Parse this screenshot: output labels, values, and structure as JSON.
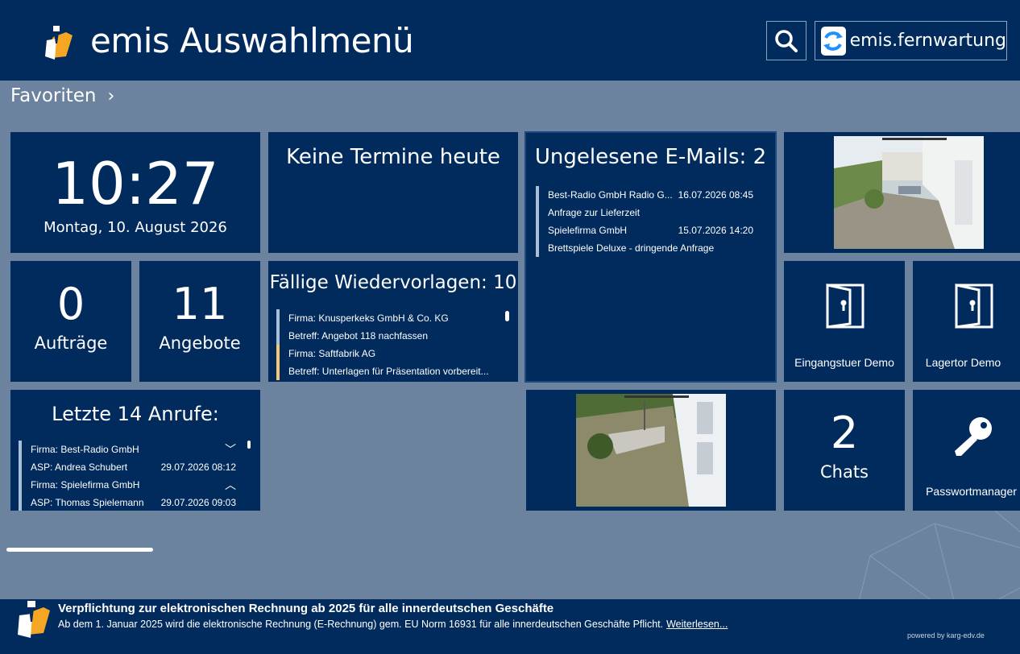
{
  "header": {
    "title": "emis Auswahlmenü",
    "fernwartung_label": "emis.fernwartung"
  },
  "favorites": {
    "label": "Favoriten"
  },
  "clock": {
    "time": "10:27",
    "date": "Montag, 10. August 2026"
  },
  "appointments": {
    "title": "Keine Termine heute"
  },
  "emails": {
    "title": "Ungelesene E-Mails: 2",
    "items": [
      {
        "from": "Best-Radio GmbH Radio G...",
        "date": "16.07.2026 08:45",
        "subject": "Anfrage zur Lieferzeit"
      },
      {
        "from": "Spielefirma GmbH",
        "date": "15.07.2026 14:20",
        "subject": "Brettspiele Deluxe - dringende Anfrage"
      }
    ]
  },
  "orders": {
    "count": "0",
    "label": "Aufträge"
  },
  "offers": {
    "count": "11",
    "label": "Angebote"
  },
  "followups": {
    "title": "Fällige Wiedervorlagen: 10",
    "items": [
      {
        "company": "Firma: Knusperkeks GmbH & Co. KG",
        "subject": "Betreff: Angebot 118 nachfassen",
        "color": "#a9bfd6"
      },
      {
        "company": "Firma: Saftfabrik AG",
        "subject": "Betreff: Unterlagen für Präsentation vorbereit...",
        "color": "#f2c77a"
      }
    ]
  },
  "doors": [
    {
      "label": "Eingangstuer Demo"
    },
    {
      "label": "Lagertor Demo"
    }
  ],
  "calls": {
    "title": "Letzte 14 Anrufe:",
    "items": [
      {
        "company": "Firma: Best-Radio GmbH",
        "contact": "ASP: Andrea Schubert",
        "date": "29.07.2026 08:12"
      },
      {
        "company": "Firma: Spielefirma GmbH",
        "contact": "ASP: Thomas Spielemann",
        "date": "29.07.2026 09:03"
      }
    ]
  },
  "chats": {
    "count": "2",
    "label": "Chats"
  },
  "password": {
    "label": "Passwortmanager"
  },
  "footer": {
    "title": "Verpflichtung zur elektronischen Rechnung ab 2025 für alle innerdeutschen Geschäfte",
    "text": "Ab dem 1. Januar 2025 wird die  elektronische Rechnung (E-Rechnung) gem. EU Norm 16931 für alle innerdeutschen Geschäfte Pflicht.",
    "link": "Weiterlesen...",
    "powered": "powered by karg-edv.de"
  },
  "colors": {
    "tile": "#002b5c",
    "background": "#6b839e",
    "accent": "#f5a623"
  }
}
